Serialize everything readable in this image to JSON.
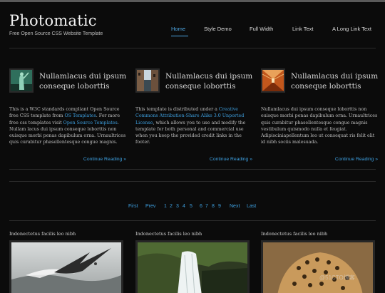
{
  "header": {
    "logo": "Photomatic",
    "tagline": "Free Open Source CSS Website Template"
  },
  "nav": {
    "items": [
      "Home",
      "Style Demo",
      "Full Width",
      "Link Text",
      "A Long Link Text"
    ],
    "active": "Home"
  },
  "posts": [
    {
      "title": "Nullamlacus dui ipsum conseque loborttis",
      "body": [
        {
          "t": "This is a W3C standards compliant Open Source free CSS template from "
        },
        {
          "link": "OS Templates"
        },
        {
          "t": ". For more free css templates visit "
        },
        {
          "link": "Open Source Templates"
        },
        {
          "t": ". Nullam lacus dui ipsum conseque loborttis non euisque morbi penas dapibulum orna. Urnaultrices quis curabitur phasellentesque congue magnis."
        }
      ],
      "more": "Continue Reading »"
    },
    {
      "title": "Nullamlacus dui ipsum conseque loborttis",
      "body": [
        {
          "t": "This template is distributed under a "
        },
        {
          "link": "Creative Commons Attribution-Share Alike 3.0 Unported License"
        },
        {
          "t": ", which allows you to use and modify the template for both personal and commercial use when you keep the provided credit links in the footer."
        }
      ],
      "more": "Continue Reading »"
    },
    {
      "title": "Nullamlacus dui ipsum conseque loborttis",
      "body": [
        {
          "t": "Nullamlacus dui ipsum conseque loborttis non euisque morbi penas dapibulum orna. Urnaultrices quis curabitur phasellentesque congue magnis vestibulum quismodo nulla et feugiat. Adipisciniapellentum leo ut consequat ris felit elit id nibh sociis malesuada."
        }
      ],
      "more": "Continue Reading »"
    }
  ],
  "pagination": {
    "first": "First",
    "prev": "Prev",
    "pages": [
      "1",
      "2",
      "3",
      "4",
      "5",
      "6",
      "7",
      "8",
      "9"
    ],
    "next": "Next",
    "last": "Last"
  },
  "gallery": [
    {
      "caption": "Indonectetus facilis leo nibh",
      "icon": "bird-over-water-photo"
    },
    {
      "caption": "Indonectetus facilis leo nibh",
      "icon": "waterfall-photo"
    },
    {
      "caption": "Indonectetus facilis leo nibh",
      "icon": "leopard-photo"
    }
  ],
  "watermark": "@51CTO博客",
  "colors": {
    "accent": "#4fa9e6",
    "background": "#0b0b0b"
  }
}
